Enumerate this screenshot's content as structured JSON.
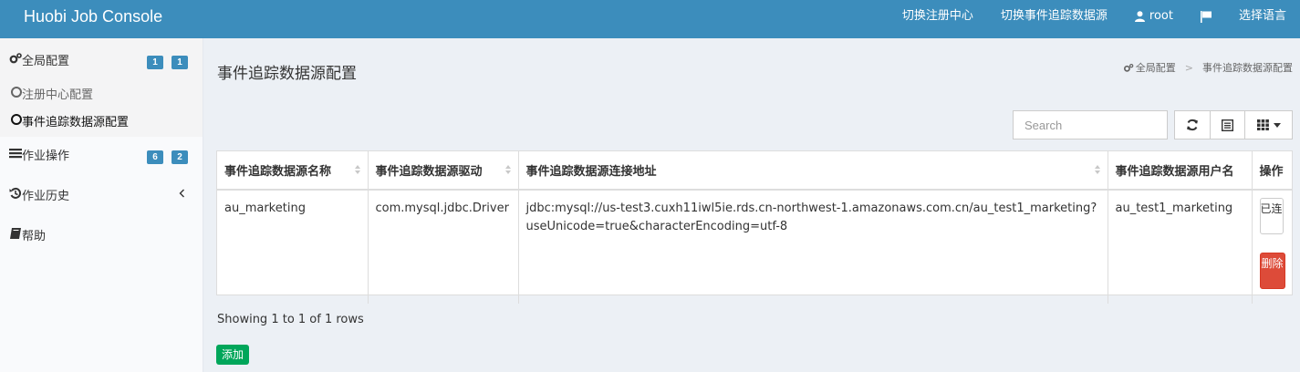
{
  "topbar": {
    "brand": "Huobi Job Console",
    "nav": {
      "switch_registry": "切换注册中心",
      "switch_datasource": "切换事件追踪数据源",
      "user": "root",
      "language": "选择语言"
    },
    "icons": {
      "user": "user-icon",
      "flag": "flag-icon"
    }
  },
  "sidebar": {
    "global_config": {
      "label": "全局配置",
      "badge_1": "1",
      "badge_2": "1",
      "icon": "gears-icon"
    },
    "sub_items": [
      {
        "label": "注册中心配置",
        "active": false
      },
      {
        "label": "事件追踪数据源配置",
        "active": true
      }
    ],
    "job_ops": {
      "label": "作业操作",
      "badge_1": "6",
      "badge_2": "2",
      "icon": "list-icon"
    },
    "job_history": {
      "label": "作业历史",
      "icon": "history-icon"
    },
    "help": {
      "label": "帮助",
      "icon": "book-icon"
    }
  },
  "main": {
    "title": "事件追踪数据源配置",
    "breadcrumb": {
      "parent": "全局配置",
      "current": "事件追踪数据源配置"
    },
    "toolbar": {
      "search_placeholder": "Search",
      "refresh_icon": "refresh-icon",
      "toggle_icon": "list-view-icon",
      "columns_icon": "grid-columns-icon"
    },
    "table": {
      "headers": [
        "事件追踪数据源名称",
        "事件追踪数据源驱动",
        "事件追踪数据源连接地址",
        "事件追踪数据源用户名",
        "操作"
      ],
      "rows": [
        {
          "name": "au_marketing",
          "driver": "com.mysql.jdbc.Driver",
          "url": "jdbc:mysql://us-test3.cuxh11iwl5ie.rds.cn-northwest-1.amazonaws.com.cn/au_test1_marketing?useUnicode=true&characterEncoding=utf-8",
          "username": "au_test1_marketing",
          "btn_connected": "已连",
          "btn_delete": "删除"
        }
      ]
    },
    "pagination_info": "Showing 1 to 1 of 1 rows",
    "add_button": "添加"
  },
  "colors": {
    "topbar": "#3c8dbc",
    "badge": "#3c8dbc",
    "delete": "#dd4b39",
    "add": "#00a65a",
    "content_bg": "#ecf0f5"
  }
}
